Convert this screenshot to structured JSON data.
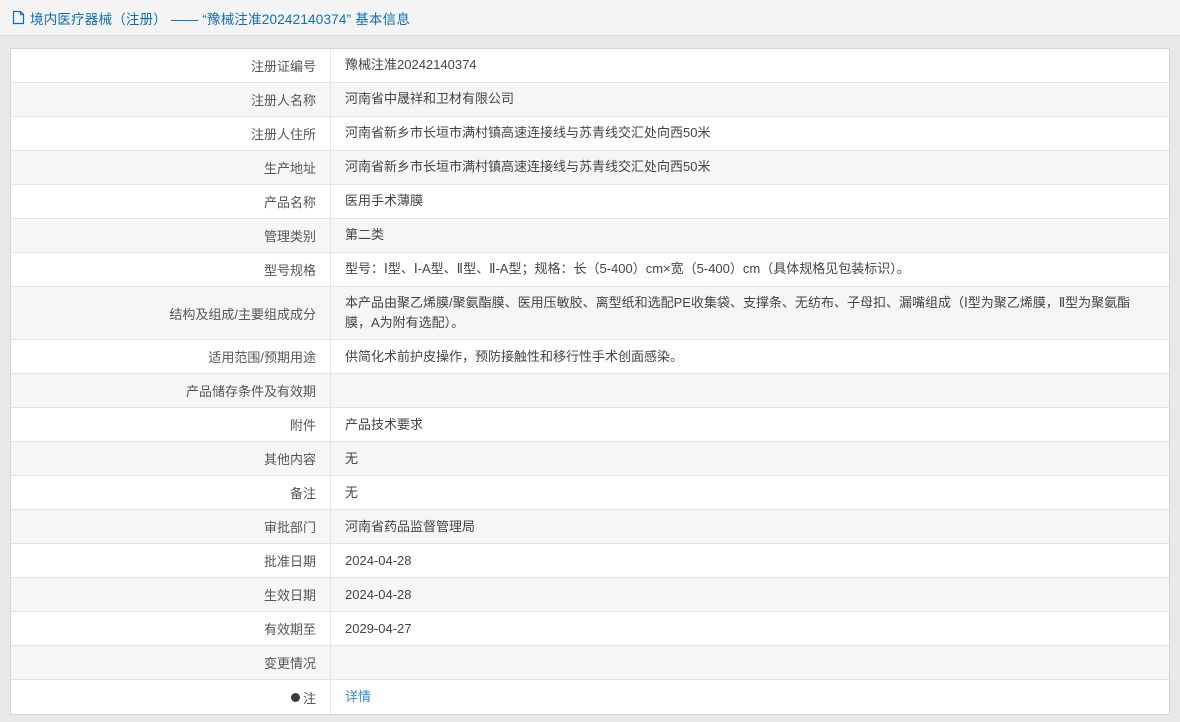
{
  "header": {
    "title": "境内医疗器械（注册） —— “豫械注准20242140374” 基本信息"
  },
  "table": {
    "rows": [
      {
        "label": "注册证编号",
        "value": "豫械注准20242140374"
      },
      {
        "label": "注册人名称",
        "value": "河南省中晟祥和卫材有限公司"
      },
      {
        "label": "注册人住所",
        "value": "河南省新乡市长垣市满村镇高速连接线与苏青线交汇处向西50米"
      },
      {
        "label": "生产地址",
        "value": "河南省新乡市长垣市满村镇高速连接线与苏青线交汇处向西50米"
      },
      {
        "label": "产品名称",
        "value": "医用手术薄膜"
      },
      {
        "label": "管理类别",
        "value": "第二类"
      },
      {
        "label": "型号规格",
        "value": "型号：Ⅰ型、Ⅰ-A型、Ⅱ型、Ⅱ-A型；规格：长（5-400）cm×宽（5-400）cm（具体规格见包装标识）。"
      },
      {
        "label": "结构及组成/主要组成成分",
        "value": "本产品由聚乙烯膜/聚氨酯膜、医用压敏胶、离型纸和选配PE收集袋、支撑条、无纺布、子母扣、漏嘴组成（Ⅰ型为聚乙烯膜，Ⅱ型为聚氨酯膜，A为附有选配）。"
      },
      {
        "label": "适用范围/预期用途",
        "value": "供简化术前护皮操作，预防接触性和移行性手术创面感染。"
      },
      {
        "label": "产品储存条件及有效期",
        "value": ""
      },
      {
        "label": "附件",
        "value": "产品技术要求"
      },
      {
        "label": "其他内容",
        "value": "无"
      },
      {
        "label": "备注",
        "value": "无"
      },
      {
        "label": "审批部门",
        "value": "河南省药品监督管理局"
      },
      {
        "label": "批准日期",
        "value": "2024-04-28"
      },
      {
        "label": "生效日期",
        "value": "2024-04-28"
      },
      {
        "label": "有效期至",
        "value": "2029-04-27"
      },
      {
        "label": "变更情况",
        "value": ""
      },
      {
        "label": "注",
        "label_icon": "bullet-icon",
        "value": "详情",
        "value_type": "link"
      }
    ]
  },
  "colors": {
    "title_blue": "#0e6eb8",
    "link_blue": "#2a8fd0"
  }
}
